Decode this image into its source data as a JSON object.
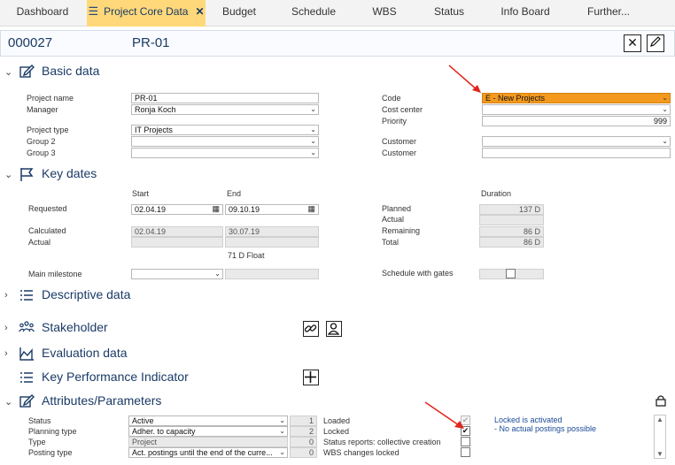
{
  "tabs": [
    {
      "label": "Dashboard"
    },
    {
      "label": "Project Core Data",
      "active": true
    },
    {
      "label": "Budget"
    },
    {
      "label": "Schedule"
    },
    {
      "label": "WBS"
    },
    {
      "label": "Status"
    },
    {
      "label": "Info Board"
    },
    {
      "label": "Further..."
    }
  ],
  "tab_close": "✕",
  "header": {
    "project_id": "000027",
    "project_code": "PR-01"
  },
  "sections": {
    "basic": "Basic data",
    "keydates": "Key dates",
    "descriptive": "Descriptive data",
    "stakeholder": "Stakeholder",
    "evaluation": "Evaluation data",
    "kpi": "Key Performance Indicator",
    "attributes": "Attributes/Parameters"
  },
  "basic": {
    "project_name_label": "Project name",
    "project_name": "PR-01",
    "manager_label": "Manager",
    "manager": "Ronja Koch",
    "project_type_label": "Project type",
    "project_type": "IT Projects",
    "group2_label": "Group 2",
    "group2": "",
    "group3_label": "Group 3",
    "group3": "",
    "code_label": "Code",
    "code": "E - New Projects",
    "cost_center_label": "Cost center",
    "cost_center": "",
    "priority_label": "Priority",
    "priority": "999",
    "customer_label": "Customer",
    "customer": "",
    "customer2_label": "Customer",
    "customer2": ""
  },
  "keydates": {
    "start_label": "Start",
    "end_label": "End",
    "duration_label": "Duration",
    "requested_label": "Requested",
    "requested_start": "02.04.19",
    "requested_end": "09.10.19",
    "calculated_label": "Calculated",
    "calculated_start": "02.04.19",
    "calculated_end": "30.07.19",
    "actual_label": "Actual",
    "actual_start": "",
    "actual_end": "",
    "float_text": "71 D Float",
    "main_milestone_label": "Main milestone",
    "planned_label": "Planned",
    "planned": "137 D",
    "actual2_label": "Actual",
    "actual2": "",
    "remaining_label": "Remaining",
    "remaining": "86 D",
    "total_label": "Total",
    "total": "86 D",
    "schedule_gates_label": "Schedule with gates"
  },
  "attributes": {
    "status_label": "Status",
    "status": "Active",
    "status_num": "1",
    "planning_type_label": "Planning type",
    "planning_type": "Adher. to capacity",
    "planning_num": "2",
    "type_label": "Type",
    "type": "Project",
    "type_num": "0",
    "posting_type_label": "Posting type",
    "posting_type": "Act. postings until the end of the curre...",
    "posting_num": "0",
    "loaded_label": "Loaded",
    "locked_label": "Locked",
    "status_reports_label": "Status reports: collective creation",
    "wbs_locked_label": "WBS changes locked",
    "note_line1": "Locked is activated",
    "note_line2": "- No actual postings possible"
  },
  "colors": {
    "accent": "#1a3a66",
    "active_tab": "#ffd87a",
    "code_field": "#f39a1e",
    "arrow": "#e0261c"
  }
}
